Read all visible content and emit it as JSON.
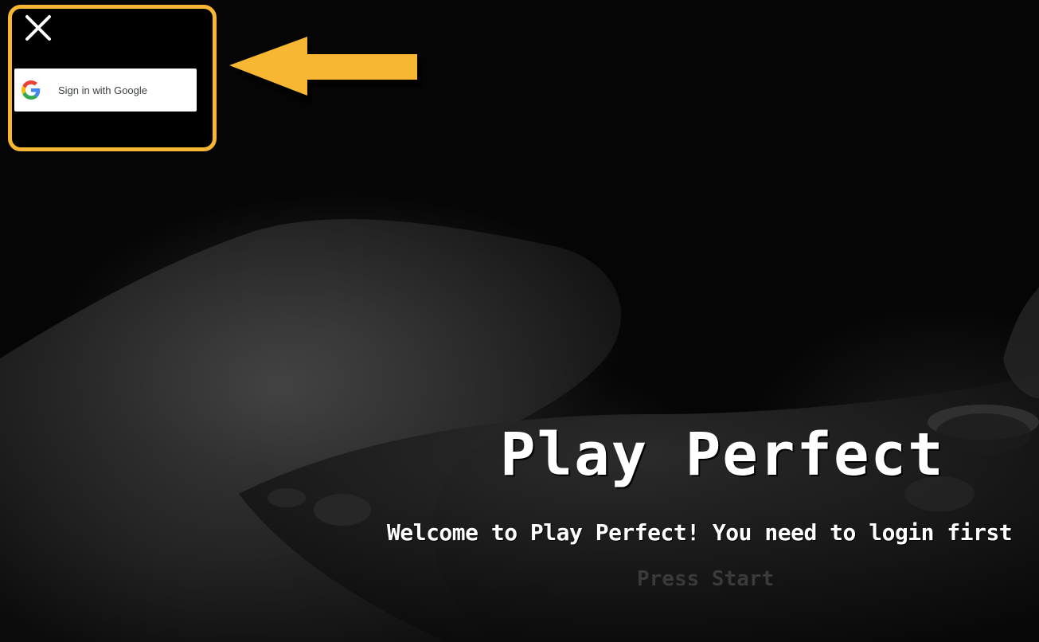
{
  "auth": {
    "google_button_label": "Sign in with Google",
    "close_icon": "close-icon",
    "google_icon": "google-logo-icon"
  },
  "hero": {
    "title": "Play Perfect",
    "welcome_message": "Welcome to Play Perfect! You need to login first",
    "press_start": "Press Start"
  },
  "colors": {
    "highlight": "#f7b733",
    "background": "#000000",
    "title_text": "#ffffff",
    "press_start_text": "#3a3a3a"
  }
}
